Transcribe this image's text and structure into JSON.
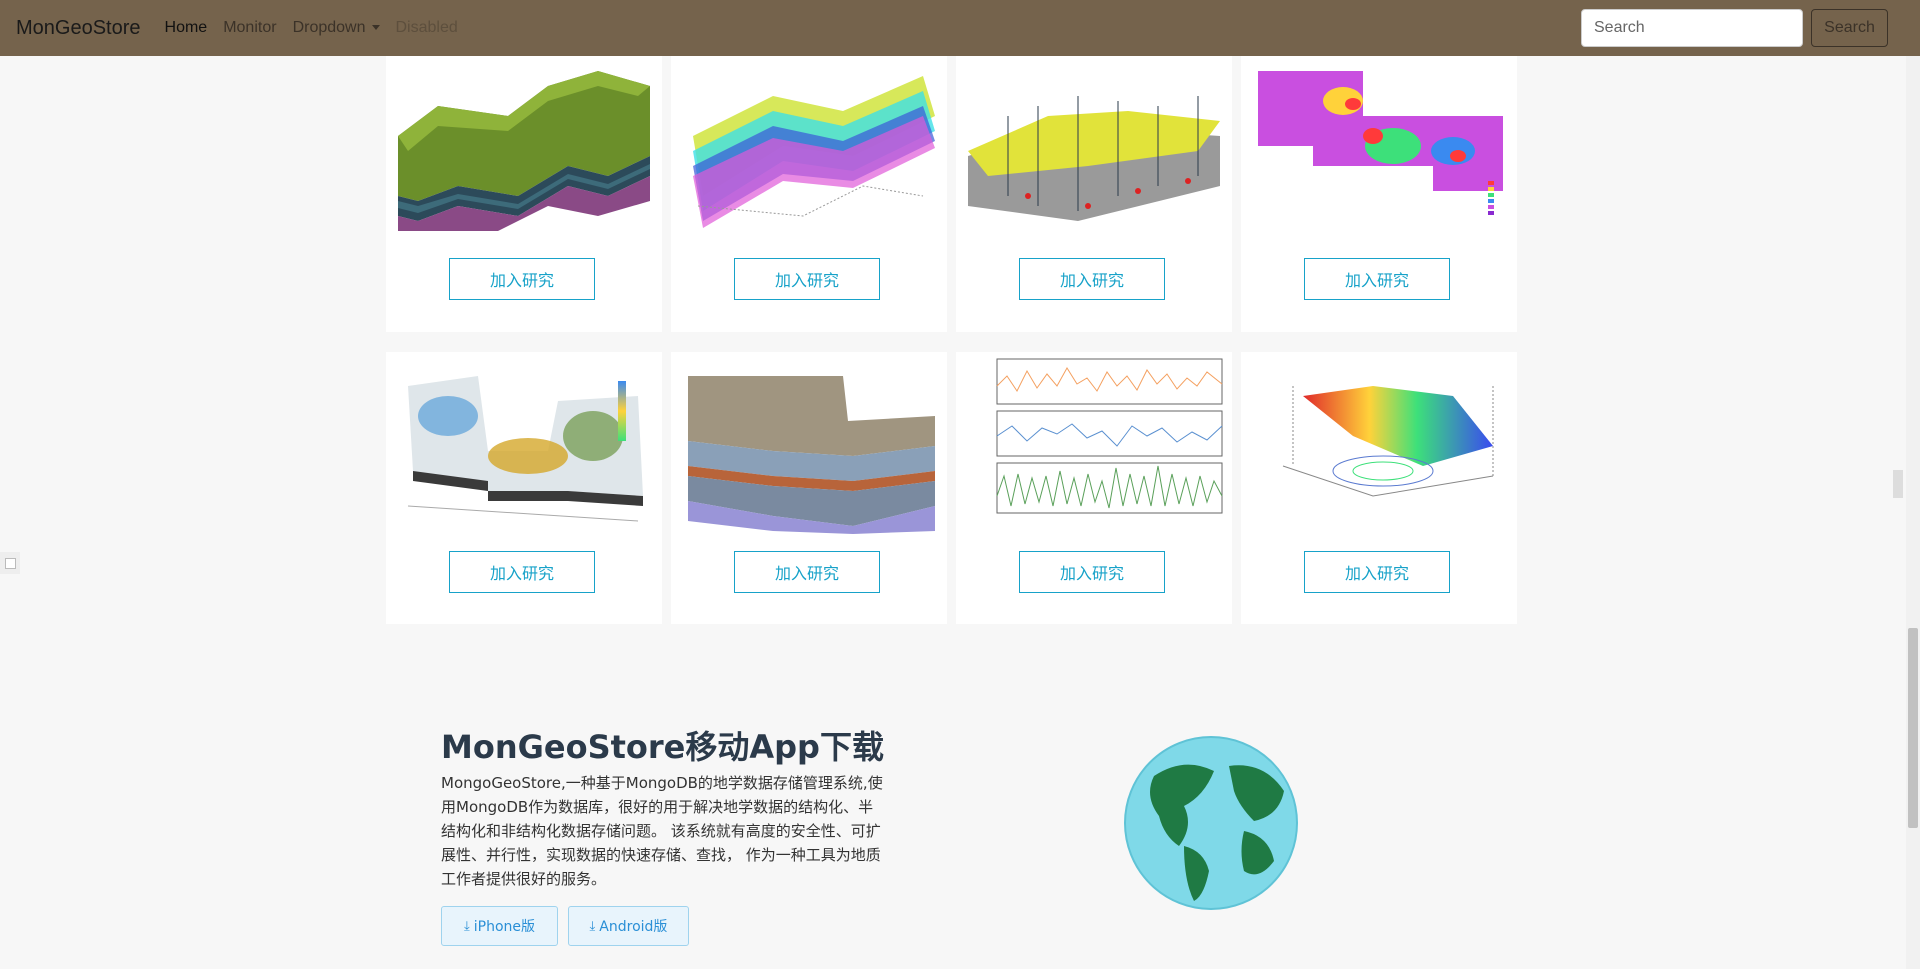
{
  "navbar": {
    "brand": "MonGeoStore",
    "links": [
      "Home",
      "Monitor",
      "Dropdown",
      "Disabled"
    ],
    "search_placeholder": "Search",
    "search_button": "Search"
  },
  "cards": [
    {
      "image": "geological-block-model",
      "button": "加入研究"
    },
    {
      "image": "fence-diagram-model",
      "button": "加入研究"
    },
    {
      "image": "well-surface-3d-model",
      "button": "加入研究"
    },
    {
      "image": "contour-heatmap-map",
      "button": "加入研究"
    },
    {
      "image": "terrain-elevation-3d",
      "button": "加入研究"
    },
    {
      "image": "stratigraphic-block-model",
      "button": "加入研究"
    },
    {
      "image": "time-series-plots",
      "button": "加入研究"
    },
    {
      "image": "mse-surface-plot",
      "button": "加入研究"
    }
  ],
  "app_section": {
    "title": "MonGeoStore移动App下载",
    "description": "MongoGeoStore,一种基于MongoDB的地学数据存储管理系统,使用MongoDB作为数据库，很好的用于解决地学数据的结构化、半结构化和非结构化数据存储问题。 该系统就有高度的安全性、可扩展性、并行性，实现数据的快速存储、查找， 作为一种工具为地质工作者提供很好的服务。",
    "buttons": [
      {
        "label": "iPhone版",
        "icon": "download-icon"
      },
      {
        "label": "Android版",
        "icon": "download-icon"
      }
    ],
    "image": "globe-illustration"
  },
  "colors": {
    "navbar": "#75634c",
    "accent": "#17a2c9",
    "page_bg": "#f7f7f7"
  }
}
